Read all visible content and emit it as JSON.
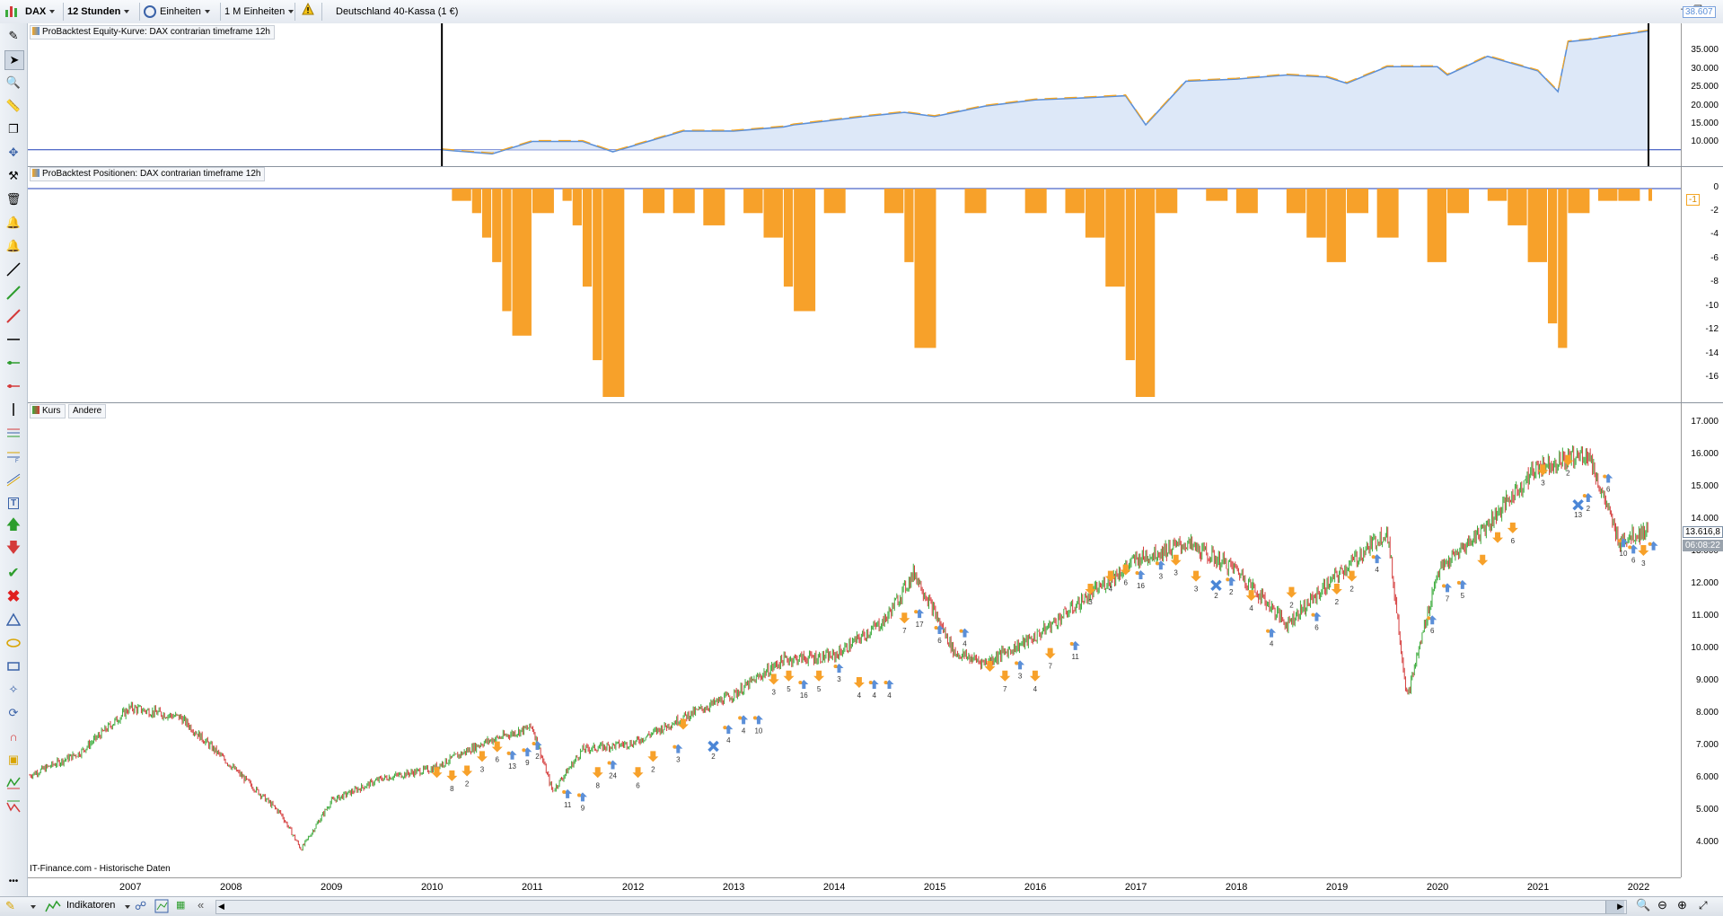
{
  "toolbar": {
    "instrument": "DAX",
    "timeframe": "12 Stunden",
    "units": "Einheiten",
    "size": "1 M Einheiten",
    "market": "Deutschland 40-Kassa (1 €)"
  },
  "panels": {
    "equity": {
      "legend": "ProBacktest Equity-Kurve: DAX contrarian timeframe 12h",
      "last_value": "38.607",
      "ticks": [
        "35.000",
        "30.000",
        "25.000",
        "20.000",
        "15.000",
        "10.000"
      ]
    },
    "positions": {
      "legend": "ProBacktest Positionen: DAX contrarian timeframe 12h",
      "last_value": "-1",
      "ticks": [
        "0",
        "-2",
        "-4",
        "-6",
        "-8",
        "-10",
        "-12",
        "-14",
        "-16"
      ]
    },
    "price": {
      "legend_kurs": "Kurs",
      "legend_andere": "Andere",
      "last_value": "13.616,8",
      "last_time": "06:08:22",
      "ticks": [
        "17.000",
        "16.000",
        "15.000",
        "14.000",
        "13.000",
        "12.000",
        "11.000",
        "10.000",
        "9.000",
        "8.000",
        "7.000",
        "6.000",
        "5.000",
        "4.000"
      ],
      "source": "IT-Finance.com - Historische Daten"
    }
  },
  "xaxis": {
    "years": [
      "2007",
      "2008",
      "2009",
      "2010",
      "2011",
      "2012",
      "2013",
      "2014",
      "2015",
      "2016",
      "2017",
      "2018",
      "2019",
      "2020",
      "2021",
      "2022"
    ]
  },
  "bottom": {
    "indicators": "Indikatoren"
  },
  "colors": {
    "equity_line": "#f5a623",
    "equity_fill": "#dde8f8",
    "equity_blue": "#5b8fd8",
    "position_bar": "#f7a12a",
    "candle_up": "#3cab3c",
    "candle_down": "#d43a3a"
  },
  "chart_data": [
    {
      "type": "area",
      "title": "ProBacktest Equity-Kurve: DAX contrarian timeframe 12h",
      "x": [
        2010.6,
        2011.1,
        2011.5,
        2012.0,
        2012.3,
        2013.0,
        2013.5,
        2014.0,
        2014.1,
        2014.8,
        2015.0,
        2015.2,
        2015.5,
        2016.0,
        2016.5,
        2017.0,
        2017.4,
        2017.6,
        2018.0,
        2018.5,
        2019.0,
        2019.4,
        2019.6,
        2020.0,
        2020.5,
        2020.6,
        2021.0,
        2021.5,
        2021.7,
        2021.8,
        2022.0,
        2022.6
      ],
      "y": [
        10000,
        9000,
        12000,
        12000,
        9500,
        14500,
        14500,
        15500,
        16000,
        18000,
        18500,
        19000,
        18000,
        20500,
        22000,
        22500,
        23000,
        16000,
        26500,
        27000,
        28000,
        27500,
        26000,
        30000,
        30000,
        28000,
        32500,
        29000,
        24000,
        36000,
        36500,
        38607
      ],
      "ylim": [
        8000,
        40000
      ]
    },
    {
      "type": "bar",
      "title": "ProBacktest Positionen: DAX contrarian timeframe 12h",
      "x": [
        2010.7,
        2010.9,
        2011.0,
        2011.1,
        2011.2,
        2011.3,
        2011.5,
        2011.8,
        2011.9,
        2012.0,
        2012.1,
        2012.2,
        2012.6,
        2012.9,
        2013.2,
        2013.6,
        2013.8,
        2014.0,
        2014.1,
        2014.4,
        2015.0,
        2015.2,
        2015.3,
        2015.8,
        2016.4,
        2016.8,
        2017.0,
        2017.2,
        2017.4,
        2017.5,
        2017.7,
        2018.2,
        2018.5,
        2019.0,
        2019.2,
        2019.4,
        2019.6,
        2019.9,
        2020.4,
        2020.6,
        2021.0,
        2021.2,
        2021.4,
        2021.6,
        2021.7,
        2021.8,
        2022.1,
        2022.3,
        2022.6
      ],
      "values": [
        -1,
        -2,
        -4,
        -6,
        -10,
        -12,
        -2,
        -1,
        -3,
        -8,
        -14,
        -17,
        -2,
        -2,
        -3,
        -2,
        -4,
        -8,
        -10,
        -2,
        -2,
        -6,
        -13,
        -2,
        -2,
        -2,
        -4,
        -8,
        -14,
        -17,
        -2,
        -1,
        -2,
        -2,
        -4,
        -6,
        -2,
        -4,
        -6,
        -2,
        -1,
        -3,
        -6,
        -11,
        -13,
        -2,
        -1,
        -1,
        -1
      ],
      "ylim": [
        -17,
        0
      ]
    },
    {
      "type": "line",
      "title": "Kurs",
      "x": [
        2006.5,
        2007.0,
        2007.5,
        2008.0,
        2008.5,
        2009.0,
        2009.2,
        2009.5,
        2010.0,
        2010.5,
        2011.0,
        2011.5,
        2011.7,
        2012.0,
        2012.5,
        2013.0,
        2013.5,
        2014.0,
        2014.5,
        2015.0,
        2015.3,
        2015.7,
        2016.0,
        2016.5,
        2017.0,
        2017.5,
        2018.0,
        2018.5,
        2019.0,
        2019.5,
        2020.0,
        2020.2,
        2020.5,
        2021.0,
        2021.5,
        2022.0,
        2022.3,
        2022.6
      ],
      "y": [
        6000,
        6700,
        8100,
        7800,
        6300,
        4800,
        3700,
        5200,
        5900,
        6200,
        7000,
        7500,
        5500,
        6800,
        7000,
        7800,
        8500,
        9600,
        9700,
        10800,
        12300,
        9800,
        9500,
        10300,
        11500,
        12700,
        13200,
        12400,
        10700,
        12200,
        13600,
        8400,
        12300,
        13800,
        15600,
        16000,
        13300,
        13616.8
      ],
      "ylim": [
        3500,
        17000
      ]
    }
  ]
}
